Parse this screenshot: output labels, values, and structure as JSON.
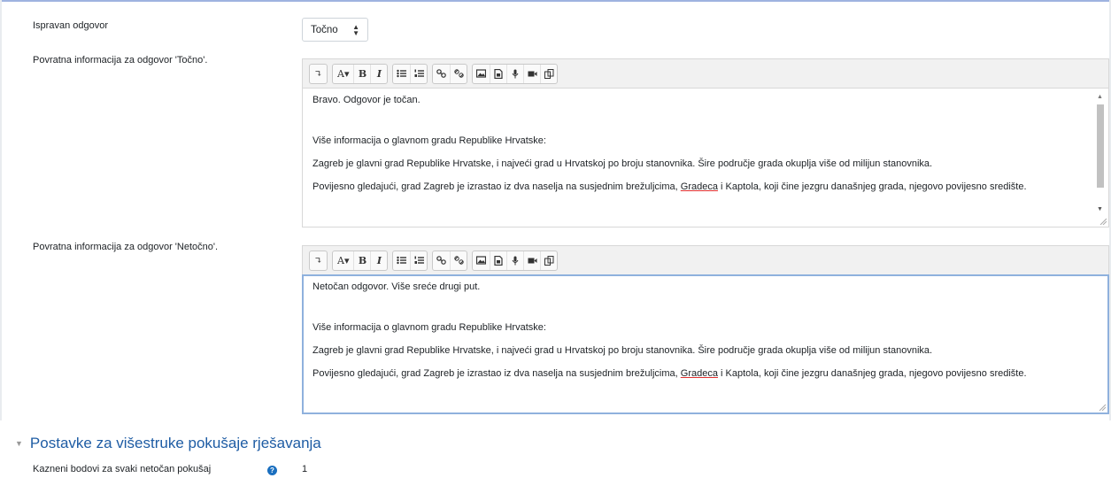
{
  "correct_answer": {
    "label": "Ispravan odgovor",
    "selected": "Točno"
  },
  "toolbar": {
    "collapse_glyph": "↴",
    "font_label": "A▾",
    "bold_label": "B",
    "italic_label": "I",
    "icons": [
      "show-more-icon",
      "font-style-icon",
      "bold-icon",
      "italic-icon",
      "bulleted-list-icon",
      "numbered-list-icon",
      "link-icon",
      "unlink-icon",
      "image-icon",
      "media-icon",
      "record-audio-icon",
      "record-video-icon",
      "manage-files-icon"
    ]
  },
  "feedback_true": {
    "label": "Povratna informacija za odgovor 'Točno'.",
    "line1": "Bravo. Odgovor je točan.",
    "line2": "Više informacija o glavnom gradu Republike Hrvatske:",
    "line3": "Zagreb je glavni grad Republike Hrvatske, i najveći grad u Hrvatskoj po broju stanovnika. Šire područje grada okuplja više od milijun stanovnika.",
    "line4_before": "Povijesno gledajući, grad Zagreb je izrastao iz dva naselja na susjednim brežuljcima, ",
    "line4_spell": "Gradeca",
    "line4_after": " i Kaptola, koji čine jezgru današnjeg grada, njegovo povijesno središte."
  },
  "feedback_false": {
    "label": "Povratna informacija za odgovor 'Netočno'.",
    "line1": "Netočan odgovor. Više sreće drugi put.",
    "line2": "Više informacija o glavnom gradu Republike Hrvatske:",
    "line3": "Zagreb je glavni grad Republike Hrvatske, i najveći grad u Hrvatskoj po broju stanovnika. Šire područje grada okuplja više od milijun stanovnika.",
    "line4_before": "Povijesno gledajući, grad Zagreb je izrastao iz dva naselja na susjednim brežuljcima, ",
    "line4_spell": "Gradeca",
    "line4_after": " i Kaptola, koji čine jezgru današnjeg grada, njegovo povijesno središte."
  },
  "multiple_tries": {
    "section_title": "Postavke za višestruke pokušaje rješavanja",
    "penalty_label": "Kazneni bodovi za svaki netočan pokušaj",
    "penalty_value": "1"
  },
  "colors": {
    "section_title": "#1e5ca4",
    "help_icon": "#1a6fbf",
    "focus_border": "#8fb1dd"
  }
}
